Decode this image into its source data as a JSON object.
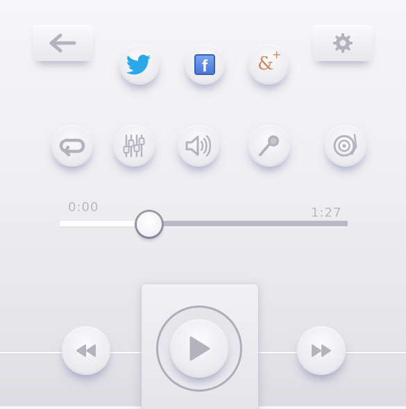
{
  "header": {
    "back_icon": "arrow-left-icon",
    "settings_icon": "gear-icon"
  },
  "social": [
    {
      "name": "twitter",
      "icon": "twitter-bird-icon",
      "color": "#2aa7e8"
    },
    {
      "name": "facebook",
      "icon": "facebook-icon",
      "label": "f",
      "color": "#5a8ae6"
    },
    {
      "name": "google-plus",
      "icon": "google-plus-icon",
      "label": "&",
      "superscript": "+",
      "color": "#d08a5a"
    }
  ],
  "controls": [
    {
      "icon": "repeat-icon"
    },
    {
      "icon": "equalizer-icon"
    },
    {
      "icon": "volume-icon"
    },
    {
      "icon": "microphone-icon"
    },
    {
      "icon": "turntable-icon"
    }
  ],
  "progress": {
    "current": "0:00",
    "total": "1:27",
    "fraction": 0.31
  },
  "transport": {
    "rewind_icon": "rewind-icon",
    "play_icon": "play-icon",
    "forward_icon": "fast-forward-icon"
  },
  "colors": {
    "icon_gray": "#b3b3bd",
    "twitter": "#2aa7e8",
    "facebook": "#5a8ae6",
    "gplus": "#d08a5a"
  }
}
